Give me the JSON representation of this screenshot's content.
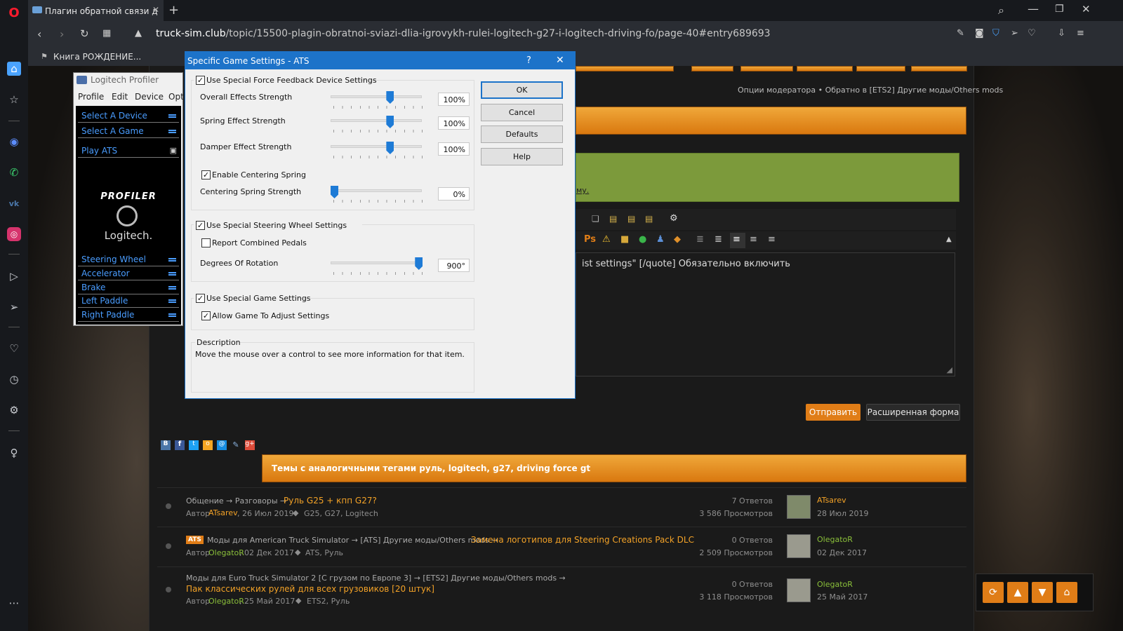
{
  "browser": {
    "tab_title": "Плагин обратной связи д",
    "new_tab": "+",
    "url_domain": "truck-sim.club",
    "url_path": "/topic/15500-plagin-obratnoi-sviazi-dlia-igrovykh-rulei-logitech-g27-i-logitech-driving-fo/page-40#entry689693",
    "bookmark": "Книга РОЖДЕНИЕ..."
  },
  "sidebar_icons": [
    "opera-logo",
    "home-icon",
    "star-icon",
    "messenger-icon",
    "whatsapp-icon",
    "vk-icon",
    "instagram-icon",
    "player-icon",
    "send-icon",
    "heart-icon",
    "history-icon",
    "settings-icon",
    "bulb-icon",
    "more-icon"
  ],
  "forum": {
    "moderator_links": "Опции модератора • Обратно в [ETS2] Другие моды/Others mods",
    "green_link": "му.",
    "quote_text": "ist settings\" [/quote] Обязательно включить",
    "submit": "Отправить",
    "advanced": "Расширенная форма",
    "similar_header": "Темы с аналогичными тегами руль, logitech, g27, driving force gt",
    "topics": [
      {
        "path": "Общение → Разговоры →",
        "title": "Руль G25 + кпп G27?",
        "author_prefix": "Автор",
        "author": "ATsarev",
        "date": ", 26 Июл 2019",
        "tags": "G25, G27, Logitech",
        "answers": "7 Ответов",
        "views": "3 586 Просмотров",
        "last_user": "ATsarev",
        "last_date": "28 Июл 2019"
      },
      {
        "badge": "ATS",
        "path": "Моды для American Truck Simulator → [ATS] Другие моды/Others mods →",
        "title": "Замена логотипов для Steering Creations Pack DLC",
        "author_prefix": "Автор",
        "author": "OlegatoR",
        "date": ", 02 Дек 2017",
        "tags": "ATS, Руль",
        "answers": "0 Ответов",
        "views": "2 509 Просмотров",
        "last_user": "OlegatoR",
        "last_date": "02 Дек 2017"
      },
      {
        "path": "Моды для Euro Truck Simulator 2 [С грузом по Европе 3] → [ETS2] Другие моды/Others mods →",
        "title": "Пак классических рулей для всех грузовиков [20 штук]",
        "author_prefix": "Автор",
        "author": "OlegatoR",
        "date": ", 25 Май 2017",
        "tags": "ETS2, Руль",
        "answers": "0 Ответов",
        "views": "3 118 Просмотров",
        "last_user": "OlegatoR",
        "last_date": "25 Май 2017"
      }
    ]
  },
  "profiler": {
    "title": "Logitech Profiler",
    "menu": [
      "Profile",
      "Edit",
      "Device",
      "Opti"
    ],
    "items_top": [
      "Select A Device",
      "Select A Game"
    ],
    "play": "Play ATS",
    "logo_word": "PROFILER",
    "brand": "Logitech.",
    "axes": [
      "Steering Wheel",
      "Accelerator",
      "Brake",
      "Left Paddle",
      "Right Paddle"
    ]
  },
  "dialog": {
    "title": "Specific Game Settings - ATS",
    "help_glyph": "?",
    "close_glyph": "✕",
    "ff_group": "Use Special Force Feedback Device Settings",
    "ff_checked": true,
    "overall_label": "Overall Effects Strength",
    "overall_value": "100%",
    "overall_level": 0.64,
    "spring_label": "Spring Effect Strength",
    "spring_value": "100%",
    "spring_level": 0.64,
    "damper_label": "Damper Effect Strength",
    "damper_value": "100%",
    "damper_level": 0.64,
    "centering_enable": "Enable Centering Spring",
    "centering_checked": true,
    "centering_label": "Centering Spring Strength",
    "centering_value": "0%",
    "centering_level": 0.0,
    "steer_group": "Use Special Steering Wheel Settings",
    "steer_checked": true,
    "combined_pedals": "Report Combined Pedals",
    "combined_checked": false,
    "rotation_label": "Degrees Of Rotation",
    "rotation_value": "900°",
    "rotation_level": 0.97,
    "game_group": "Use Special Game Settings",
    "game_checked": true,
    "allow_adjust": "Allow Game To Adjust Settings",
    "allow_checked": true,
    "description_title": "Description",
    "description_text": "Move the mouse over a control to see more information for that item.",
    "buttons": {
      "ok": "OK",
      "cancel": "Cancel",
      "defaults": "Defaults",
      "help": "Help"
    }
  },
  "check_glyph": "✓"
}
